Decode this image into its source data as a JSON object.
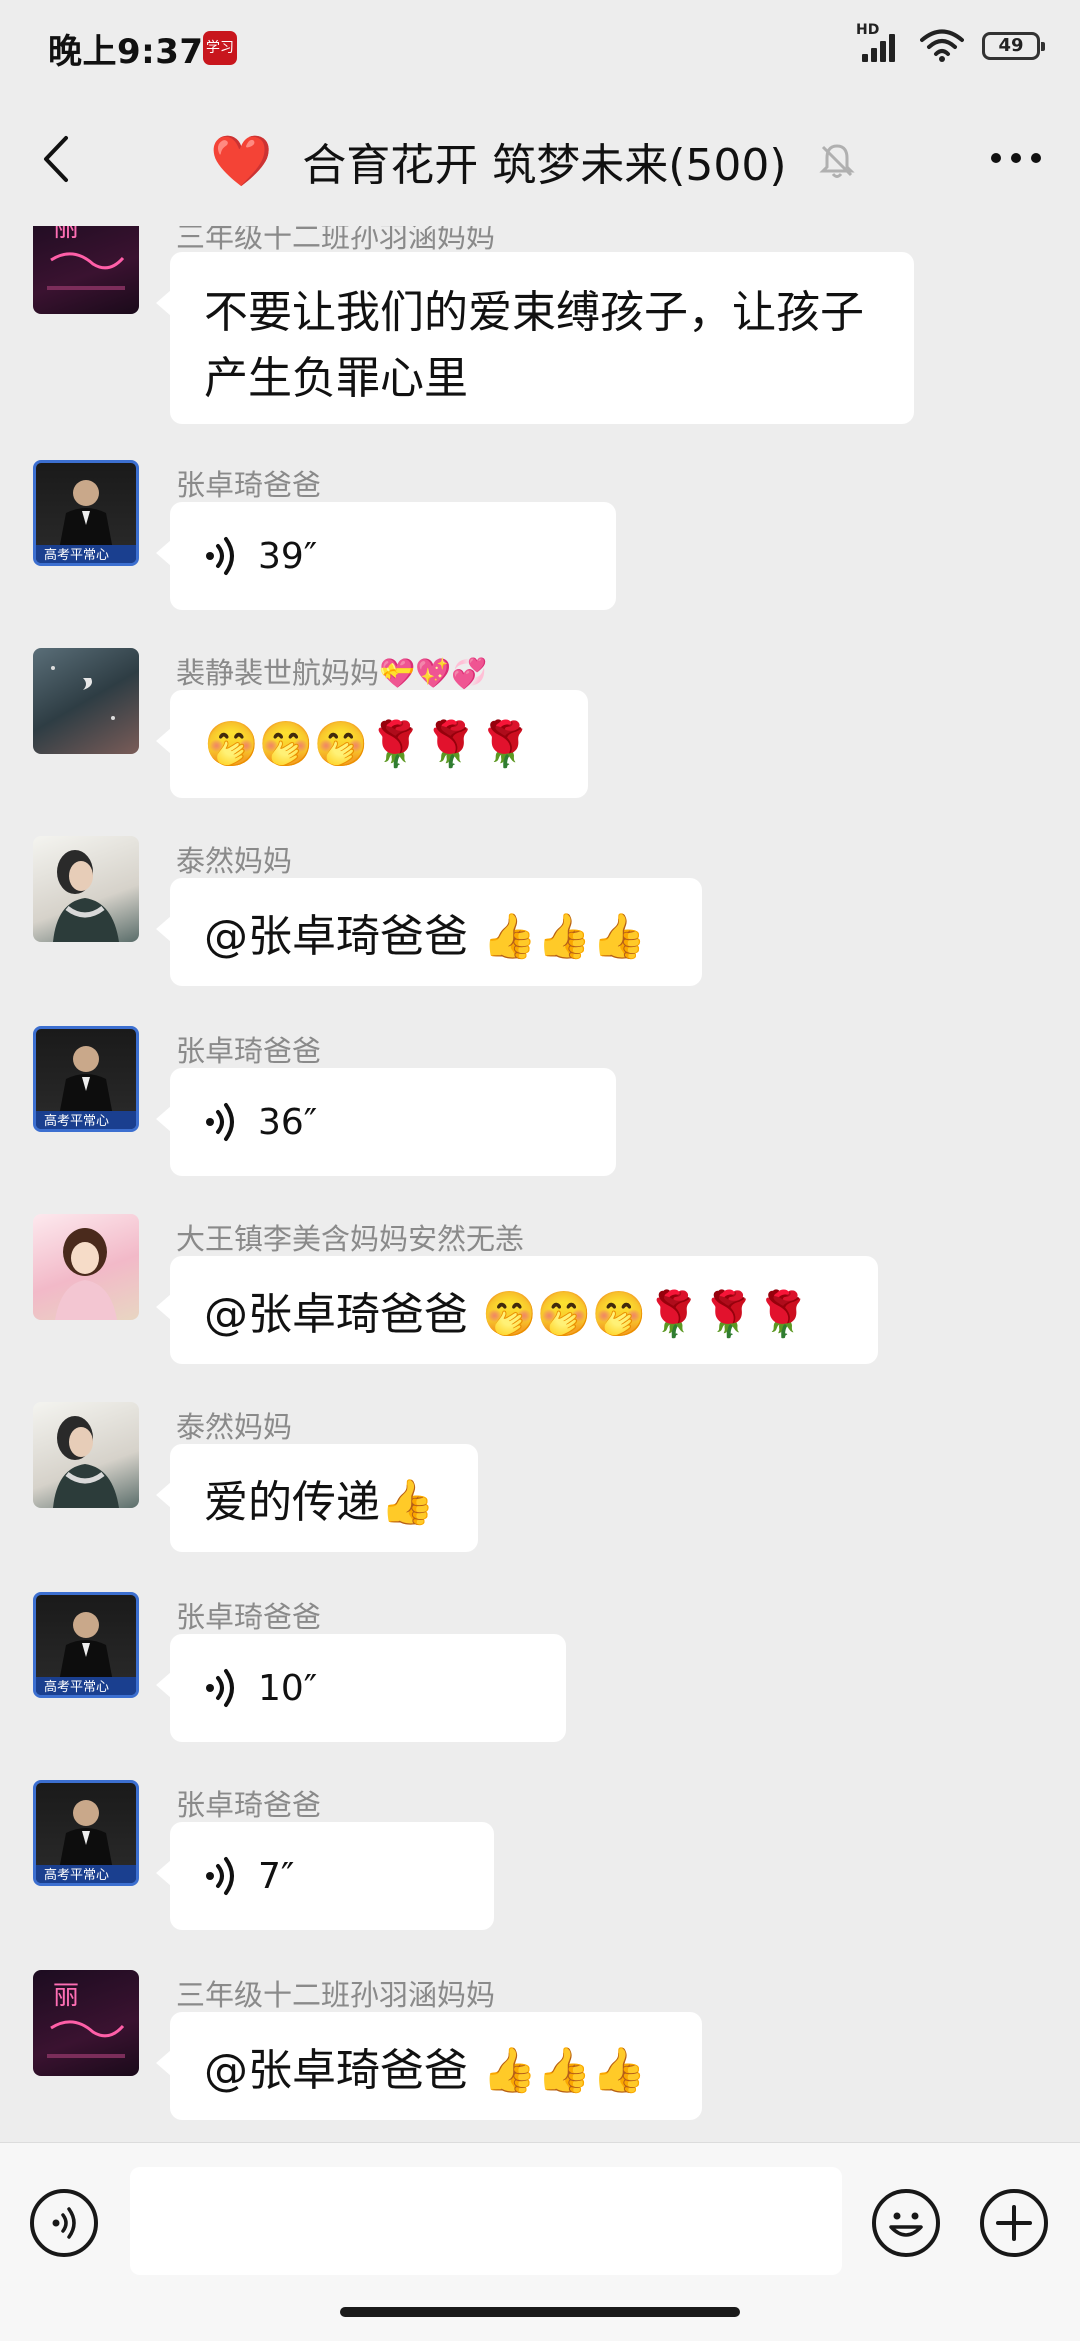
{
  "status_bar": {
    "time": "晚上9:37",
    "app_badge": "学习",
    "network": "HD",
    "battery": "49"
  },
  "header": {
    "title": "合育花开 筑梦未来(500)",
    "heart_icon": "❤️"
  },
  "messages": [
    {
      "sender": "三年级十二班孙羽涵妈妈",
      "type": "text",
      "text": "不要让我们的爱束缚孩子，让孩子产生负罪心里",
      "avatar": "pink-neon"
    },
    {
      "sender": "张卓琦爸爸",
      "type": "voice",
      "duration": "39″",
      "avatar": "suit"
    },
    {
      "sender": "裴静裴世航妈妈💝💖💞",
      "type": "text",
      "text": "🤭🤭🤭🌹🌹🌹",
      "avatar": "night"
    },
    {
      "sender": "泰然妈妈",
      "type": "text",
      "text": "@张卓琦爸爸 👍👍👍",
      "avatar": "lady"
    },
    {
      "sender": "张卓琦爸爸",
      "type": "voice",
      "duration": "36″",
      "avatar": "suit"
    },
    {
      "sender": "大王镇李美含妈妈安然无恙",
      "type": "text",
      "text": "@张卓琦爸爸 🤭🤭🤭🌹🌹🌹",
      "avatar": "girl"
    },
    {
      "sender": "泰然妈妈",
      "type": "text",
      "text": "爱的传递👍",
      "avatar": "lady"
    },
    {
      "sender": "张卓琦爸爸",
      "type": "voice",
      "duration": "10″",
      "avatar": "suit"
    },
    {
      "sender": "张卓琦爸爸",
      "type": "voice",
      "duration": "7″",
      "avatar": "suit"
    },
    {
      "sender": "三年级十二班孙羽涵妈妈",
      "type": "text",
      "text": "@张卓琦爸爸 👍👍👍",
      "avatar": "pink-neon"
    }
  ],
  "avatar_texts": {
    "suit_caption": "高考平常心",
    "pink_caption": "丽"
  },
  "input": {
    "placeholder": "",
    "value": ""
  },
  "colors": {
    "background": "#ededed",
    "bubble": "#ffffff",
    "sender_name": "#8a8a8a"
  }
}
